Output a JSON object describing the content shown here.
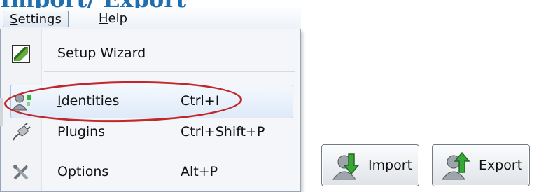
{
  "heading": {
    "text": "Import/ Export"
  },
  "menubar": {
    "items": [
      {
        "label": "Settings",
        "active": true
      },
      {
        "label": "Help",
        "active": false
      }
    ]
  },
  "settings_menu": {
    "items": [
      {
        "icon": "setup-wizard-icon",
        "label_hot": "",
        "label_rest": "Setup Wizard",
        "shortcut": ""
      },
      {
        "icon": "identities-icon",
        "label_hot": "I",
        "label_rest": "dentities",
        "shortcut": "Ctrl+I",
        "hover": true,
        "circled": true
      },
      {
        "icon": "plugins-icon",
        "label_hot": "P",
        "label_rest": "lugins",
        "shortcut": "Ctrl+Shift+P"
      },
      {
        "icon": "options-icon",
        "label_hot": "O",
        "label_rest": "ptions",
        "shortcut": "Alt+P"
      }
    ]
  },
  "buttons": {
    "import": {
      "label": "Import",
      "icon": "import-icon"
    },
    "export": {
      "label": "Export",
      "icon": "export-icon"
    }
  },
  "colors": {
    "heading": "#1f6fb0",
    "highlight_circle": "#c0282b",
    "hover_border": "#a9c3e6"
  }
}
